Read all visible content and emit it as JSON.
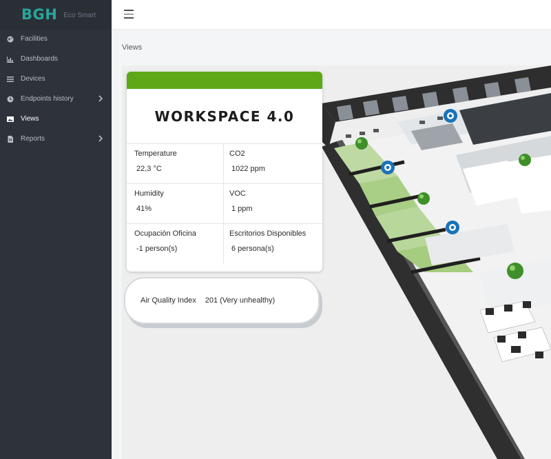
{
  "brand": {
    "logo": "BGH",
    "subtitle": "Eco Smart"
  },
  "sidebar": {
    "items": [
      {
        "label": "Facilities",
        "icon": "globe-icon",
        "has_children": false,
        "active": false
      },
      {
        "label": "Dashboards",
        "icon": "bar-chart-icon",
        "has_children": false,
        "active": false
      },
      {
        "label": "Devices",
        "icon": "list-icon",
        "has_children": false,
        "active": false
      },
      {
        "label": "Endpoints history",
        "icon": "clock-icon",
        "has_children": true,
        "active": false
      },
      {
        "label": "Views",
        "icon": "image-icon",
        "has_children": false,
        "active": true
      },
      {
        "label": "Reports",
        "icon": "file-icon",
        "has_children": true,
        "active": false
      }
    ]
  },
  "breadcrumb": "Views",
  "card": {
    "title": "WORKSPACE 4.0",
    "header_color": "#5ea817",
    "metrics": [
      {
        "label": "Temperature",
        "value": "22,3 °C"
      },
      {
        "label": "CO2",
        "value": "1022 ppm"
      },
      {
        "label": "Humidity",
        "value": "41%"
      },
      {
        "label": "VOC",
        "value": "1 ppm"
      },
      {
        "label": "Ocupación Oficina",
        "value": "-1 person(s)"
      },
      {
        "label": "Escritorios Disponibles",
        "value": "6 persona(s)"
      }
    ]
  },
  "aqi": {
    "label": "Air Quality Index",
    "value": "201 (Very unhealthy)"
  },
  "colors": {
    "sidebar": "#2e333b",
    "accent": "#2aa59a",
    "sensor_green": "#3f8f2a",
    "sensor_blue": "#1a73b8"
  }
}
